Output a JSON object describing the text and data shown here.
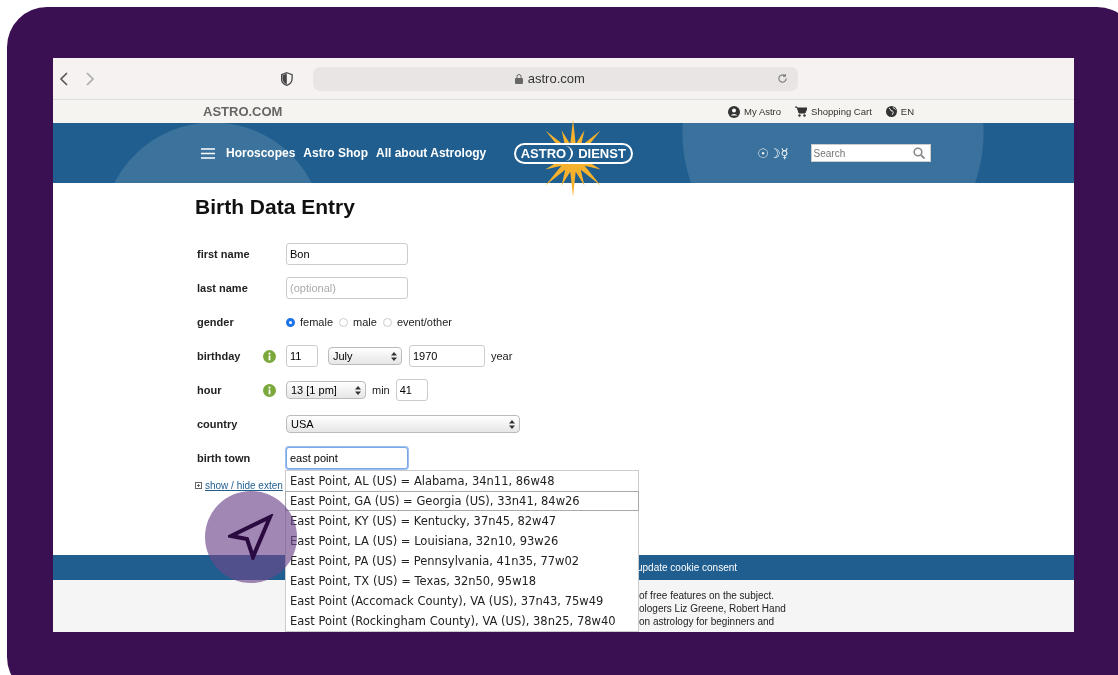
{
  "browser": {
    "url": "astro.com"
  },
  "top_bar": {
    "brand": "ASTRO.COM",
    "links": [
      {
        "kind": "account",
        "label": "My Astro"
      },
      {
        "kind": "cart",
        "label": "Shopping Cart"
      },
      {
        "kind": "language",
        "label": "EN"
      }
    ]
  },
  "nav": {
    "links": [
      "Horoscopes",
      "Astro Shop",
      "All about Astrology"
    ],
    "logo": {
      "left": "ASTRO",
      "right": "DIENST"
    },
    "symbols": "☉☽☿",
    "search": {
      "placeholder": "Search"
    }
  },
  "form": {
    "title": "Birth Data Entry",
    "fields": [
      {
        "kind": "text",
        "label": "first name",
        "value": "Bon"
      },
      {
        "kind": "text",
        "label": "last name",
        "placeholder": "(optional)"
      },
      {
        "kind": "radio",
        "label": "gender",
        "options": [
          {
            "label": "female",
            "selected": true
          },
          {
            "label": "male",
            "selected": false
          },
          {
            "label": "event/other",
            "selected": false
          }
        ]
      },
      {
        "kind": "date",
        "label": "birthday",
        "day": "11",
        "month": "July",
        "year": "1970",
        "year_label": "year"
      },
      {
        "kind": "time",
        "label": "hour",
        "hour": "13 [1 pm]",
        "min_label": "min",
        "minute": "41"
      },
      {
        "kind": "select",
        "label": "country",
        "value": "USA"
      },
      {
        "kind": "text",
        "label": "birth town",
        "value": "east point",
        "focused": true
      }
    ],
    "extended_link": "show / hide exten"
  },
  "suggestions": [
    {
      "label": "East Point, AL (US) = Alabama, 34n11, 86w48",
      "selected": false
    },
    {
      "label": "East Point, GA (US) = Georgia (US), 33n41, 84w26",
      "selected": true
    },
    {
      "label": "East Point, KY (US) = Kentucky, 37n45, 82w47",
      "selected": false
    },
    {
      "label": "East Point, LA (US) = Louisiana, 32n10, 93w26",
      "selected": false
    },
    {
      "label": "East Point, PA (US) = Pennsylvania, 41n35, 77w02",
      "selected": false
    },
    {
      "label": "East Point, TX (US) = Texas, 32n50, 95w18",
      "selected": false
    },
    {
      "label": "East Point (Accomack County), VA (US), 37n43, 75w49",
      "selected": false
    },
    {
      "label": "East Point (Rockingham County), VA (US), 38n25, 78w40",
      "selected": false
    }
  ],
  "cookie_bar": {
    "text": "update cookie consent"
  },
  "footer": {
    "lines": [
      "of free features on the subject.",
      "ologers Liz Greene, Robert Hand",
      "on astrology for beginners and"
    ]
  }
}
